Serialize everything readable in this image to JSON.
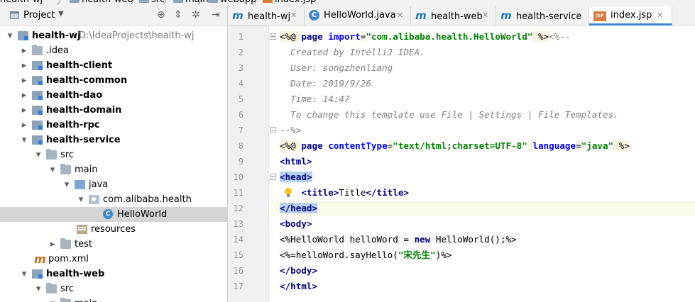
{
  "breadcrumb": {
    "items": [
      "health-wj",
      "health-web",
      "src",
      "main",
      "webapp",
      "index.jsp"
    ]
  },
  "project_panel": {
    "title": "Project",
    "dropdown_icon": "chevron-down-icon",
    "tree": [
      {
        "label": "health-wj",
        "path": "D:\\IdeaProjects\\health-wj",
        "bold": true,
        "icon": "module-folder-icon",
        "expanded": true
      },
      {
        "label": ".idea",
        "bold": false,
        "icon": "folder-icon",
        "expanded": false
      },
      {
        "label": "health-client",
        "bold": true,
        "icon": "module-folder-icon",
        "expanded": false
      },
      {
        "label": "health-common",
        "bold": true,
        "icon": "module-folder-icon",
        "expanded": false
      },
      {
        "label": "health-dao",
        "bold": true,
        "icon": "module-folder-icon",
        "expanded": false
      },
      {
        "label": "health-domain",
        "bold": true,
        "icon": "module-folder-icon",
        "expanded": false
      },
      {
        "label": "health-rpc",
        "bold": true,
        "icon": "module-folder-icon",
        "expanded": false
      },
      {
        "label": "health-service",
        "bold": true,
        "icon": "module-folder-icon",
        "expanded": true
      },
      {
        "label": "src",
        "bold": false,
        "icon": "folder-icon",
        "expanded": true
      },
      {
        "label": "main",
        "bold": false,
        "icon": "folder-icon",
        "expanded": true
      },
      {
        "label": "java",
        "bold": false,
        "icon": "source-folder-icon",
        "expanded": true
      },
      {
        "label": "com.alibaba.health",
        "bold": false,
        "icon": "package-icon",
        "expanded": true
      },
      {
        "label": "HelloWorld",
        "bold": false,
        "icon": "class-icon",
        "selected": true
      },
      {
        "label": "resources",
        "bold": false,
        "icon": "resources-folder-icon"
      },
      {
        "label": "test",
        "bold": false,
        "icon": "folder-icon",
        "expanded": false
      },
      {
        "label": "pom.xml",
        "bold": false,
        "icon": "maven-icon"
      },
      {
        "label": "health-web",
        "bold": true,
        "icon": "module-folder-icon",
        "expanded": true
      },
      {
        "label": "src",
        "bold": false,
        "icon": "folder-icon",
        "expanded": true
      },
      {
        "label": "main",
        "bold": false,
        "icon": "folder-icon",
        "expanded": true
      }
    ]
  },
  "editor": {
    "tabs": [
      {
        "label": "health-wj",
        "icon": "maven-module-icon",
        "active": false
      },
      {
        "label": "HelloWorld.java",
        "icon": "class-icon",
        "active": false
      },
      {
        "label": "health-web",
        "icon": "maven-module-icon",
        "active": false
      },
      {
        "label": "health-service",
        "icon": "maven-module-icon",
        "active": false
      },
      {
        "label": "index.jsp",
        "icon": "jsp-file-icon",
        "active": true
      }
    ],
    "line_numbers": [
      "1",
      "2",
      "3",
      "4",
      "5",
      "6",
      "7",
      "8",
      "9",
      "10",
      "11",
      "12",
      "13",
      "14",
      "15",
      "16",
      "17"
    ],
    "lines": [
      [
        [
          "dir",
          "<%@ "
        ],
        [
          "kw",
          "page "
        ],
        [
          "at",
          "import"
        ],
        [
          "dir",
          "="
        ],
        [
          "sv",
          "\"com.alibaba.health.HelloWorld\""
        ],
        [
          "dir",
          " %>"
        ],
        [
          "cm",
          "<%--"
        ]
      ],
      [
        [
          "cm",
          "  Created by IntelliJ IDEA."
        ]
      ],
      [
        [
          "cm",
          "  User: songzhenliang"
        ]
      ],
      [
        [
          "cm",
          "  Date: 2019/9/26"
        ]
      ],
      [
        [
          "cm",
          "  Time: 14:47"
        ]
      ],
      [
        [
          "cm",
          "  To change this template use File | Settings | File Templates."
        ]
      ],
      [
        [
          "cm",
          "--%>"
        ]
      ],
      [
        [
          "dir",
          "<%@ "
        ],
        [
          "kw",
          "page "
        ],
        [
          "at",
          "contentType"
        ],
        [
          "dir",
          "="
        ],
        [
          "sv",
          "\"text/html;charset=UTF-8\""
        ],
        [
          "dir",
          " "
        ],
        [
          "at",
          "language"
        ],
        [
          "dir",
          "="
        ],
        [
          "sv",
          "\"java\""
        ],
        [
          "dir",
          " %>"
        ]
      ],
      [
        [
          "kw",
          "<html>"
        ]
      ],
      [
        [
          "kwsel",
          "<head>"
        ]
      ],
      [
        [
          "pl",
          "    "
        ],
        [
          "kw",
          "<title>"
        ],
        [
          "pl",
          "Title"
        ],
        [
          "kw",
          "</title>"
        ]
      ],
      [
        [
          "kwsel",
          "</head>"
        ]
      ],
      [
        [
          "kw",
          "<body>"
        ]
      ],
      [
        [
          "js",
          "<%HelloWorld helloWord = "
        ],
        [
          "jskw",
          "new"
        ],
        [
          "js",
          " HelloWorld();%>"
        ]
      ],
      [
        [
          "js",
          "<%=helloWord.sayHello("
        ],
        [
          "sv",
          "\"宋先生\""
        ],
        [
          "js",
          ")%>"
        ]
      ],
      [
        [
          "kw",
          "</body>"
        ]
      ],
      [
        [
          "kw",
          "</html>"
        ]
      ]
    ]
  }
}
